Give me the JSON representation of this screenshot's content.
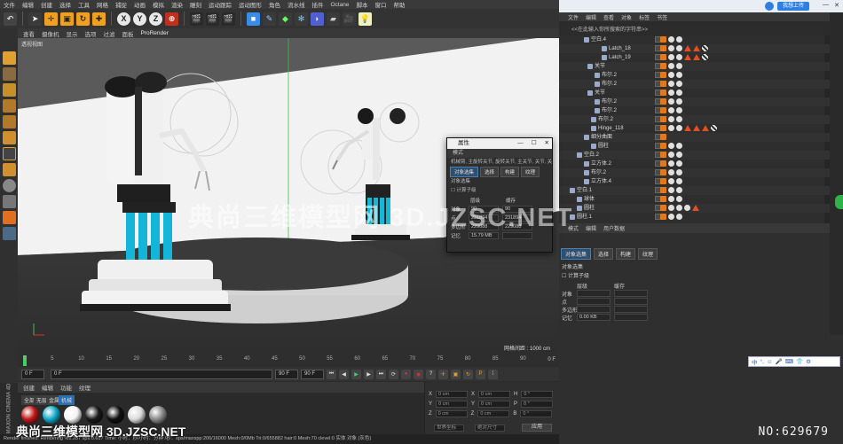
{
  "menubar": [
    "文件",
    "编辑",
    "创建",
    "选择",
    "工具",
    "网格",
    "捕捉",
    "动画",
    "模拟",
    "渲染",
    "雕刻",
    "运动跟踪",
    "运动图形",
    "角色",
    "流水线",
    "插件",
    "Octane",
    "脚本",
    "窗口",
    "帮助"
  ],
  "toolbar": {
    "axis_x": "X",
    "axis_y": "Y",
    "axis_z": "Z"
  },
  "viewport": {
    "menu": [
      "查看",
      "摄像机",
      "显示",
      "选项",
      "过滤",
      "面板",
      "ProRender"
    ],
    "label": "透视视图",
    "grid_readout": "网格间距 : 1000 cm"
  },
  "timeline": {
    "ticks": [
      "0",
      "5",
      "10",
      "15",
      "20",
      "25",
      "30",
      "35",
      "40",
      "45",
      "50",
      "55",
      "60",
      "65",
      "70",
      "75",
      "80",
      "85",
      "90"
    ],
    "frame_end_label": "0 F",
    "current_frame": "0 F",
    "start_frame": "0 F",
    "end_frame": "90 F",
    "max_frame": "90 F"
  },
  "materials": {
    "menu": [
      "创建",
      "编辑",
      "功能",
      "纹理"
    ],
    "tabs": [
      "全部",
      "无层",
      "金属",
      "机械"
    ],
    "balls": [
      "#c01818",
      "#10a8c8",
      "#f4f4f4",
      "#1a1a1a",
      "#111111",
      "#dadada",
      "#8a8a8a"
    ]
  },
  "coords": {
    "rows": [
      {
        "a": "X",
        "av": "0 cm",
        "b": "X",
        "bv": "0 cm",
        "c": "H",
        "cv": "0 °"
      },
      {
        "a": "Y",
        "av": "0 cm",
        "b": "Y",
        "bv": "0 cm",
        "c": "P",
        "cv": "0 °"
      },
      {
        "a": "Z",
        "av": "0 cm",
        "b": "Z",
        "bv": "0 cm",
        "c": "B",
        "cv": "0 °"
      }
    ],
    "mode_world": "世界坐标",
    "mode_scale": "绝对尺寸",
    "apply": "应用"
  },
  "statusbar": "Render finished: Rendering %1.287 sps:0.617 Time: 小时：秒/小时：分钟 /秒：sps/maxspp:206/16000 Mesh:0/0Mb Tri:0/655882 hair:0 Mesh:70 clevel:0  实体 对象 (灰色)",
  "maxon": "MAXON CINEMA 4D",
  "cloud": {
    "button": "我想上传"
  },
  "objects": {
    "menu": [
      "文件",
      "编辑",
      "查看",
      "对象",
      "标签",
      "书签"
    ],
    "search": "<<在此输入你所搜索的字符串>>",
    "rows": [
      {
        "name": "空白.4",
        "indent": 36,
        "tags": [
          "o",
          "w",
          "w"
        ]
      },
      {
        "name": "Latch_18",
        "indent": 56,
        "tags": [
          "o",
          "w",
          "w",
          "r",
          "r",
          "c"
        ]
      },
      {
        "name": "Latch_19",
        "indent": 56,
        "tags": [
          "o",
          "w",
          "w",
          "r",
          "r",
          "c"
        ]
      },
      {
        "name": "关节",
        "indent": 40,
        "tags": [
          "o",
          "w",
          "w"
        ]
      },
      {
        "name": "布尔.2",
        "indent": 48,
        "tags": [
          "o",
          "w",
          "w"
        ]
      },
      {
        "name": "布尔.2",
        "indent": 48,
        "tags": [
          "o",
          "w",
          "w"
        ]
      },
      {
        "name": "关节",
        "indent": 40,
        "tags": [
          "o",
          "w",
          "w"
        ]
      },
      {
        "name": "布尔.2",
        "indent": 48,
        "tags": [
          "o",
          "w",
          "w"
        ]
      },
      {
        "name": "布尔.2",
        "indent": 48,
        "tags": [
          "o",
          "w",
          "w"
        ]
      },
      {
        "name": "布尔.2",
        "indent": 44,
        "tags": [
          "o",
          "w",
          "w"
        ]
      },
      {
        "name": "Hinge_118",
        "indent": 44,
        "tags": [
          "o",
          "w",
          "w",
          "r",
          "r",
          "r",
          "c"
        ]
      },
      {
        "name": "细分曲面",
        "indent": 36,
        "tags": [
          "o"
        ]
      },
      {
        "name": "圆柱",
        "indent": 44,
        "tags": [
          "o",
          "w",
          "w"
        ]
      },
      {
        "name": "空白.2",
        "indent": 28,
        "tags": [
          "o",
          "w",
          "w"
        ]
      },
      {
        "name": "立方体.2",
        "indent": 36,
        "tags": [
          "o",
          "w",
          "w"
        ]
      },
      {
        "name": "布尔.2",
        "indent": 36,
        "tags": [
          "o",
          "w",
          "w"
        ]
      },
      {
        "name": "立方体.4",
        "indent": 36,
        "tags": [
          "o",
          "w",
          "w"
        ]
      },
      {
        "name": "空白.1",
        "indent": 20,
        "tags": [
          "o",
          "w",
          "w"
        ]
      },
      {
        "name": "球体",
        "indent": 28,
        "tags": [
          "o",
          "w",
          "w"
        ]
      },
      {
        "name": "圆柱",
        "indent": 28,
        "tags": [
          "o",
          "w",
          "w",
          "w",
          "r"
        ]
      },
      {
        "name": "圆柱.1",
        "indent": 20,
        "tags": [
          "o",
          "w",
          "w"
        ]
      }
    ]
  },
  "attributes": {
    "menu": [
      "模式",
      "编辑",
      "用户数据"
    ],
    "tabs": [
      "对象选集",
      "选择",
      "构建",
      "纹理"
    ],
    "section": "对象选集",
    "subsection": "计算子级",
    "col1": "层级",
    "col2": "缓存",
    "labels": [
      "对象",
      "点",
      "多边形",
      "记忆"
    ],
    "memory": "0.00 KB"
  },
  "dialog": {
    "title": "属性",
    "menu": "模式",
    "breadcrumb": "机械臂, 主旋转关节, 旋转关节, 主关节, 关节, 关",
    "tabs": [
      "对象选集",
      "选择",
      "构建",
      "纹理"
    ],
    "section": "对象选集",
    "check": "计算子级",
    "col1": "层级",
    "col2": "缓存",
    "labels": [
      "对象",
      "点",
      "多边形",
      "记忆"
    ],
    "values": [
      {
        "a": "90",
        "b": "90"
      },
      {
        "a": "231894",
        "b": "231894"
      },
      {
        "a": "229088",
        "b": "229088"
      },
      {
        "a": "15.79 MB",
        "b": ""
      }
    ]
  },
  "ime": [
    "中",
    "°,",
    "☺",
    "🎤",
    "⌨",
    "👕",
    "⚙"
  ],
  "watermark": {
    "center": "典尚三维模型网 3D.JZSC.NET",
    "bottom": "典尚三维模型网 3D.JZSC.NET",
    "id": "NO:629679"
  }
}
